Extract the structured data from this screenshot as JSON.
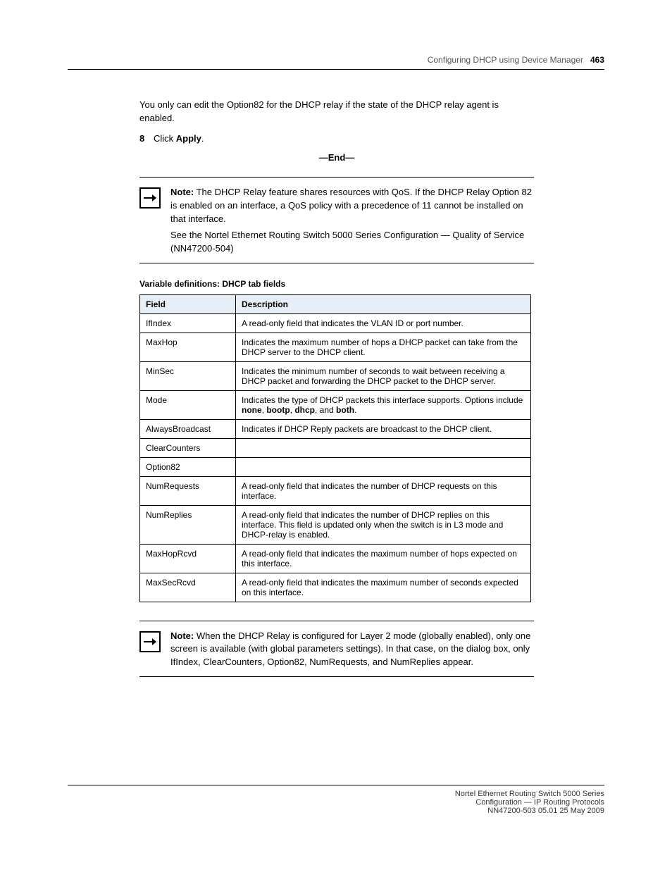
{
  "header": {
    "sectionLabel": "Configuring DHCP using Device Manager",
    "pageNumber": "463"
  },
  "intro": "You only can edit the Option82 for the DHCP relay if the state of the DHCP relay agent is enabled.",
  "step": {
    "num": "8",
    "text_pre": "Click ",
    "text_b": "Apply",
    "text_post": ""
  },
  "sepEnd": "—End—",
  "note1": {
    "label": "Note:",
    "text": " The DHCP Relay feature shares resources with QoS. If the DHCP Relay Option 82 is enabled on an interface, a QoS policy with a precedence of 11 cannot be installed on that interface."
  },
  "note1after": "See the Nortel Ethernet Routing Switch 5000 Series Configuration — Quality of Service (NN47200-504)",
  "tableCaption": {
    "bold": "Variable definitions: DHCP tab fields",
    "tail": ""
  },
  "table": {
    "headers": [
      "Field",
      "Description"
    ],
    "rows": [
      {
        "f": "IfIndex",
        "d": "A read-only field that indicates the VLAN ID or port number."
      },
      {
        "f": "MaxHop",
        "d": "Indicates the maximum number of hops a DHCP packet can take from the DHCP server to the DHCP client."
      },
      {
        "f": "MinSec",
        "d": "Indicates the minimum number of seconds to wait between receiving a DHCP packet and forwarding the DHCP packet to the DHCP server."
      },
      {
        "f": "Mode",
        "d_pre": "Indicates the type of DHCP packets this interface supports. Options include ",
        "d_b1": "none",
        "d_mid1": ", ",
        "d_b2": "bootp",
        "d_mid2": ", ",
        "d_b3": "dhcp",
        "d_mid3": ", and ",
        "d_b4": "both",
        "d_post": "."
      },
      {
        "f": "AlwaysBroadcast",
        "d": "Indicates if DHCP Reply packets are broadcast to the DHCP client."
      },
      {
        "f": "ClearCounters",
        "d": ""
      },
      {
        "f": "Option82",
        "d": ""
      },
      {
        "f": "NumRequests",
        "d": "A read-only field that indicates the number of DHCP requests on this interface."
      },
      {
        "f": "NumReplies",
        "d": "A read-only field that indicates the number of DHCP replies on this interface. This field is updated only when the switch is in L3 mode and DHCP-relay is enabled."
      },
      {
        "f": "MaxHopRcvd",
        "d": "A read-only field that indicates the maximum number of hops expected on this interface."
      },
      {
        "f": "MaxSecRcvd",
        "d": "A read-only field that indicates the maximum number of seconds expected on this interface."
      }
    ]
  },
  "note2": {
    "label": "Note:",
    "text": " When the DHCP Relay is configured for Layer 2 mode (globally enabled), only one screen is available (with global parameters settings). In that case, on the dialog box, only IfIndex, ClearCounters, Option82, NumRequests, and NumReplies appear."
  },
  "footer": "Nortel Ethernet Routing Switch 5000 Series\nConfiguration — IP Routing Protocols\nNN47200-503 05.01  25 May 2009"
}
